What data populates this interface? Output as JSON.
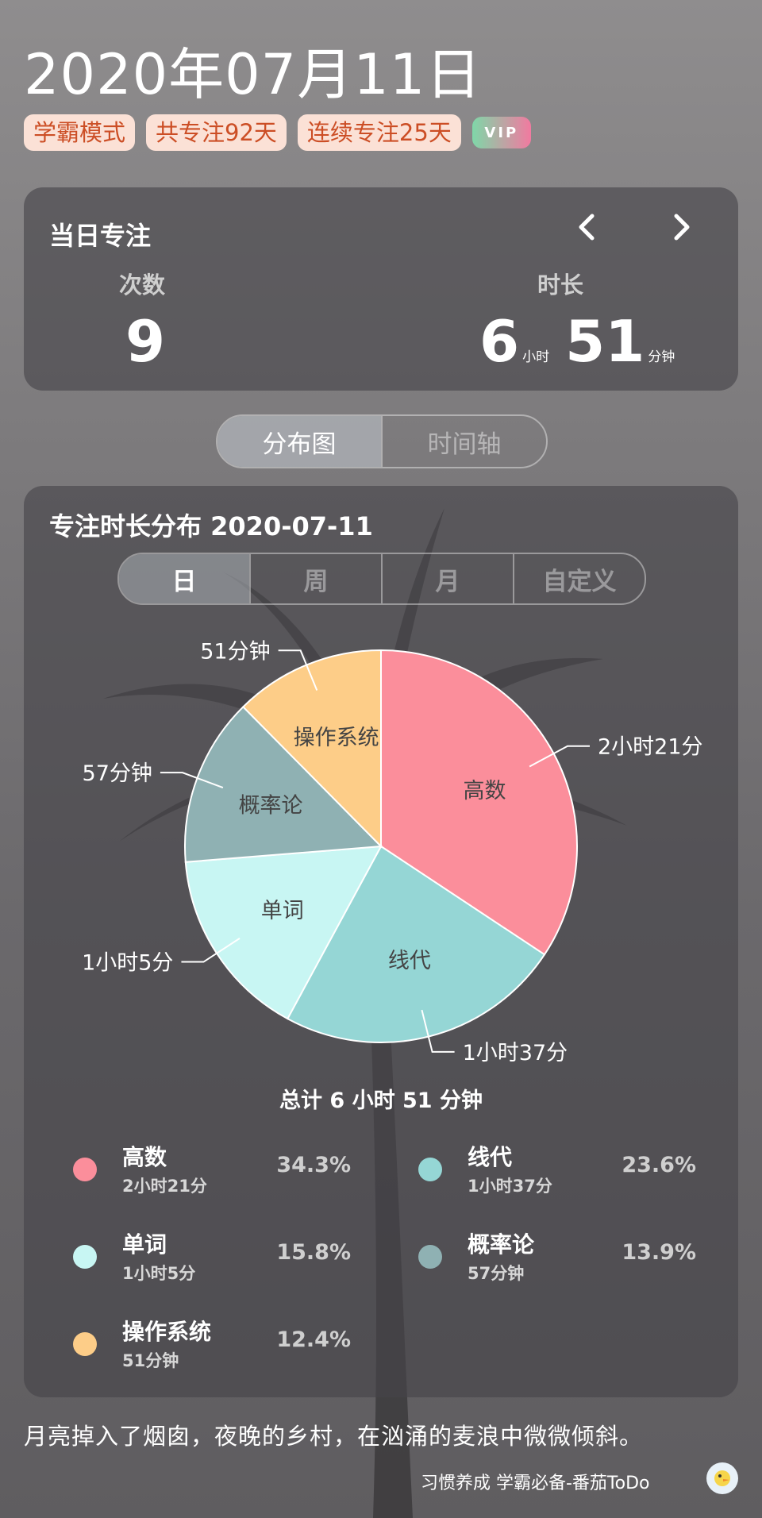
{
  "header": {
    "date": "2020年07月11日",
    "tags": [
      "学霸模式",
      "共专注92天",
      "连续专注25天"
    ],
    "vip_label": "VIP"
  },
  "daily": {
    "title": "当日专注",
    "count_label": "次数",
    "count_value": "9",
    "duration_label": "时长",
    "hours": "6",
    "hours_unit": "小时",
    "minutes": "51",
    "minutes_unit": "分钟"
  },
  "view_tabs": [
    "分布图",
    "时间轴"
  ],
  "distribution": {
    "title": "专注时长分布  2020-07-11",
    "ranges": [
      "日",
      "周",
      "月",
      "自定义"
    ],
    "total": "总计 6 小时 51 分钟"
  },
  "chart_data": {
    "type": "pie",
    "slices": [
      {
        "name": "高数",
        "duration": "2小时21分",
        "minutes": 141,
        "percent": "34.3%",
        "color": "#fb8e9b"
      },
      {
        "name": "线代",
        "duration": "1小时37分",
        "minutes": 97,
        "percent": "23.6%",
        "color": "#95d6d5"
      },
      {
        "name": "单词",
        "duration": "1小时5分",
        "minutes": 65,
        "percent": "15.8%",
        "color": "#c8f6f3"
      },
      {
        "name": "概率论",
        "duration": "57分钟",
        "minutes": 57,
        "percent": "13.9%",
        "color": "#8fb1b3"
      },
      {
        "name": "操作系统",
        "duration": "51分钟",
        "minutes": 51,
        "percent": "12.4%",
        "color": "#fdcd88"
      }
    ]
  },
  "quote": "月亮掉入了烟囱，夜晚的乡村，在汹涌的麦浪中微微倾斜。",
  "footer": "习惯养成 学霸必备-番茄ToDo"
}
